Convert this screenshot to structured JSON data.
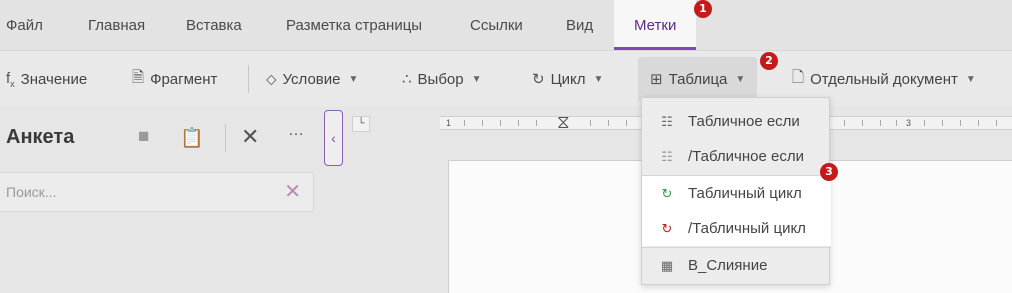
{
  "menubar": {
    "tabs": [
      {
        "label": "Файл"
      },
      {
        "label": "Главная"
      },
      {
        "label": "Вставка"
      },
      {
        "label": "Разметка страницы"
      },
      {
        "label": "Ссылки"
      },
      {
        "label": "Вид"
      },
      {
        "label": "Метки",
        "active": true
      }
    ]
  },
  "toolbar": {
    "value_label": "Значение",
    "fragment_label": "Фрагмент",
    "condition_label": "Условие",
    "choice_label": "Выбор",
    "loop_label": "Цикл",
    "table_label": "Таблица",
    "separate_doc_label": "Отдельный документ"
  },
  "panel": {
    "title": "Анкета",
    "search_placeholder": "Поиск..."
  },
  "ruler": {
    "labels": [
      "1",
      "3"
    ]
  },
  "dropdown": {
    "items": [
      {
        "label": "Табличное если",
        "icon": "table-if-icon"
      },
      {
        "label": "/Табличное если",
        "icon": "table-if-end-icon"
      },
      {
        "label": "Табличный цикл",
        "icon": "table-loop-icon",
        "highlighted": true
      },
      {
        "label": "/Табличный цикл",
        "icon": "table-loop-end-icon",
        "highlighted": true
      },
      {
        "label": "В_Слияние",
        "icon": "merge-icon"
      }
    ]
  },
  "badges": [
    "1",
    "2",
    "3"
  ],
  "colors": {
    "accent": "#7b4bb0",
    "badge": "#c61a1a",
    "highlight": "#ffffff"
  }
}
